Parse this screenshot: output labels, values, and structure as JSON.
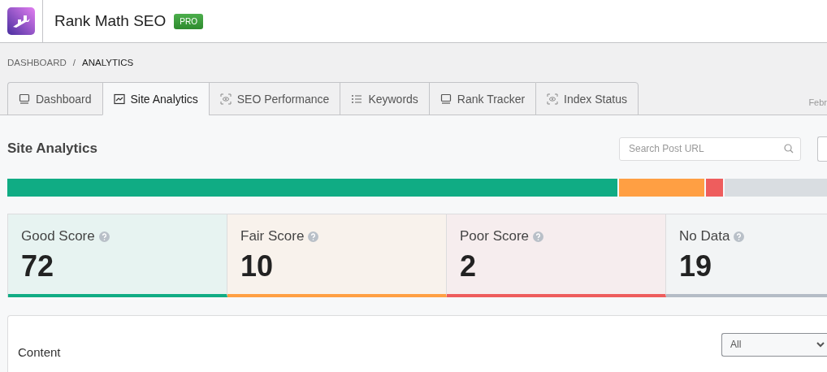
{
  "header": {
    "title": "Rank Math SEO",
    "badge": "PRO"
  },
  "breadcrumb": [
    {
      "label": "DASHBOARD",
      "selected": false
    },
    {
      "label": "ANALYTICS",
      "selected": true
    }
  ],
  "breadcrumb_separator": "/",
  "tabs": [
    {
      "label": "Dashboard",
      "selected": false
    },
    {
      "label": "Site Analytics",
      "selected": true
    },
    {
      "label": "SEO Performance",
      "selected": false
    },
    {
      "label": "Keywords",
      "selected": false
    },
    {
      "label": "Rank Tracker",
      "selected": false
    },
    {
      "label": "Index Status",
      "selected": false
    }
  ],
  "date_label": "Febr",
  "section_title": "Site Analytics",
  "search": {
    "placeholder": "Search Post URL"
  },
  "score_bar": [
    {
      "color": "#10ac84"
    },
    {
      "color": "#ff9f43"
    },
    {
      "color": "#ee5d5d"
    },
    {
      "color": "#d9dde1"
    }
  ],
  "score_cards": [
    {
      "label": "Good Score",
      "value": "72",
      "color": "#10ac84"
    },
    {
      "label": "Fair Score",
      "value": "10",
      "color": "#ff9f43"
    },
    {
      "label": "Poor Score",
      "value": "2",
      "color": "#ee5d5d"
    },
    {
      "label": "No Data",
      "value": "19",
      "color": "#b4bcc6"
    }
  ],
  "content_panel": {
    "title": "Content",
    "filter": "All"
  }
}
